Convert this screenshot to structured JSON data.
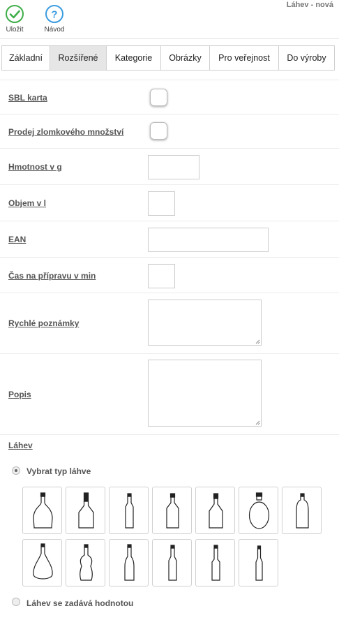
{
  "toolbar": {
    "save_label": "Uložit",
    "help_label": "Návod",
    "save_color": "#3fae49",
    "help_color": "#3b9be0"
  },
  "page": {
    "title": "Láhev - nová"
  },
  "tabs": [
    {
      "label": "Základní",
      "active": false
    },
    {
      "label": "Rozšířené",
      "active": true
    },
    {
      "label": "Kategorie",
      "active": false
    },
    {
      "label": "Obrázky",
      "active": false
    },
    {
      "label": "Pro veřejnost",
      "active": false
    },
    {
      "label": "Do výroby",
      "active": false
    }
  ],
  "fields": {
    "sbl_karta": {
      "label": "SBL karta",
      "checked": false
    },
    "prodej": {
      "label": "Prodej zlomkového množství",
      "checked": false
    },
    "hmotnost": {
      "label": "Hmotnost v g",
      "value": ""
    },
    "objem": {
      "label": "Objem v l",
      "value": ""
    },
    "ean": {
      "label": "EAN",
      "value": ""
    },
    "cas": {
      "label": "Čas na přípravu v min",
      "value": ""
    },
    "poznamky": {
      "label": "Rychlé poznámky",
      "value": ""
    },
    "popis": {
      "label": "Popis",
      "value": ""
    }
  },
  "lahev": {
    "label": "Láhev",
    "option_select": "Vybrat typ láhve",
    "option_value": "Láhev se zadává hodnotou",
    "selected": "option_select",
    "bottle_icons": [
      "cognac-bottle-icon",
      "square-bottle-icon",
      "slim-bottle-icon",
      "whisky-bottle-icon",
      "spirit-bottle-icon",
      "round-flask-icon",
      "tall-bottle-icon",
      "teardrop-bottle-icon",
      "curved-bottle-icon",
      "wine-bottle-icon",
      "narrow-bottle-icon",
      "thin-neck-bottle-icon",
      "vodka-bottle-icon"
    ]
  }
}
